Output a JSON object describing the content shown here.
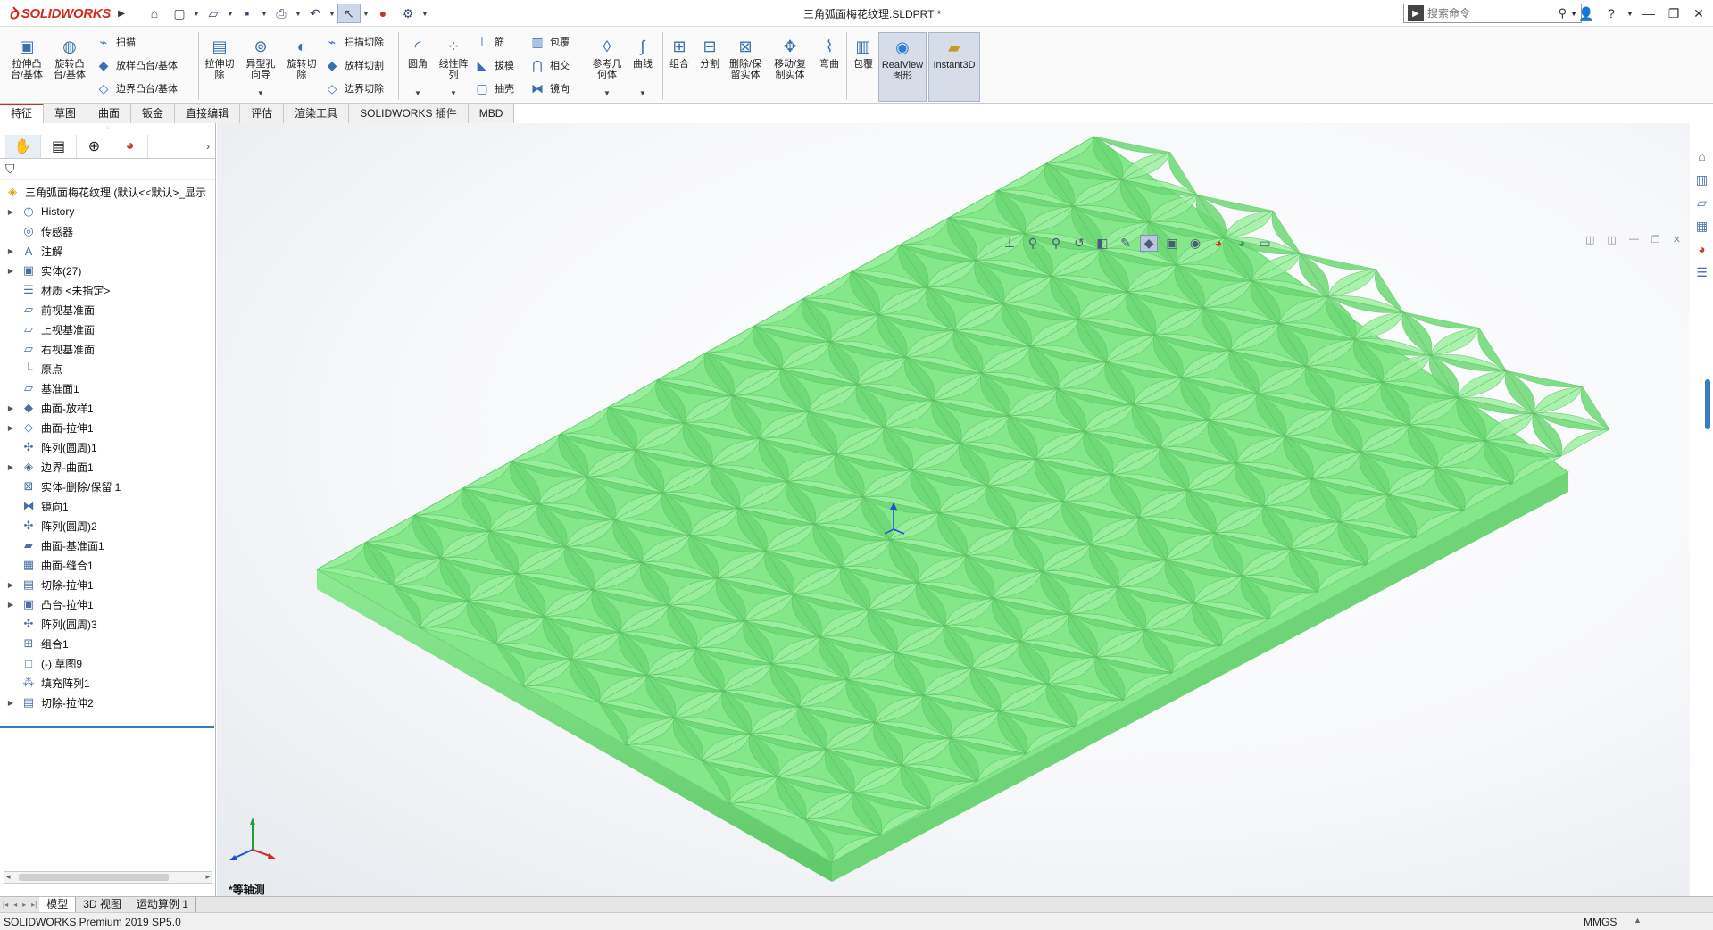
{
  "app": {
    "brand": "SOLIDWORKS",
    "doc_title": "三角弧面梅花纹理.SLDPRT *"
  },
  "search": {
    "placeholder": "搜索命令"
  },
  "toolbar": {
    "large_tools": [
      {
        "label": "拉伸凸\n台/基体",
        "icon": "extrude-boss-icon"
      },
      {
        "label": "旋转凸\n台/基体",
        "icon": "revolve-boss-icon"
      },
      {
        "label": "拉伸切\n除",
        "icon": "extrude-cut-icon"
      },
      {
        "label": "异型孔\n向导",
        "icon": "hole-wizard-icon"
      },
      {
        "label": "旋转切\n除",
        "icon": "revolve-cut-icon"
      },
      {
        "label": "圆角",
        "icon": "fillet-icon"
      },
      {
        "label": "线性阵\n列",
        "icon": "linear-pattern-icon"
      },
      {
        "label": "参考几\n何体",
        "icon": "reference-geometry-icon"
      },
      {
        "label": "曲线",
        "icon": "curves-icon"
      },
      {
        "label": "组合",
        "icon": "combine-icon"
      },
      {
        "label": "分割",
        "icon": "split-icon"
      },
      {
        "label": "删除/保\n留实体",
        "icon": "delete-keep-body-icon"
      },
      {
        "label": "移动/复\n制实体",
        "icon": "move-copy-body-icon"
      },
      {
        "label": "弯曲",
        "icon": "flex-icon"
      },
      {
        "label": "包覆",
        "icon": "wrap-icon"
      },
      {
        "label": "RealView\n图形",
        "icon": "realview-icon"
      },
      {
        "label": "Instant3D",
        "icon": "instant3d-icon"
      }
    ],
    "small_tools": [
      {
        "label": "扫描",
        "icon": "sweep-icon"
      },
      {
        "label": "放样凸台/基体",
        "icon": "loft-icon"
      },
      {
        "label": "边界凸台/基体",
        "icon": "boundary-boss-icon"
      },
      {
        "label": "扫描切除",
        "icon": "swept-cut-icon"
      },
      {
        "label": "放样切割",
        "icon": "lofted-cut-icon"
      },
      {
        "label": "边界切除",
        "icon": "boundary-cut-icon"
      },
      {
        "label": "筋",
        "icon": "rib-icon"
      },
      {
        "label": "拔模",
        "icon": "draft-icon"
      },
      {
        "label": "抽壳",
        "icon": "shell-icon"
      },
      {
        "label": "包覆",
        "icon": "wrap-icon"
      },
      {
        "label": "相交",
        "icon": "intersect-icon"
      },
      {
        "label": "镜向",
        "icon": "mirror-icon"
      }
    ]
  },
  "tabs": [
    "特征",
    "草图",
    "曲面",
    "钣金",
    "直接编辑",
    "评估",
    "渲染工具",
    "SOLIDWORKS 插件",
    "MBD"
  ],
  "tree": {
    "root": "三角弧面梅花纹理 (默认<<默认>_显示",
    "items": [
      {
        "label": "History",
        "expandable": true,
        "icon": "history-icon"
      },
      {
        "label": "传感器",
        "expandable": false,
        "icon": "sensors-icon"
      },
      {
        "label": "注解",
        "expandable": true,
        "icon": "annotations-icon"
      },
      {
        "label": "实体(27)",
        "expandable": true,
        "icon": "solid-bodies-icon"
      },
      {
        "label": "材质 <未指定>",
        "expandable": false,
        "icon": "material-icon"
      },
      {
        "label": "前视基准面",
        "expandable": false,
        "icon": "plane-icon"
      },
      {
        "label": "上视基准面",
        "expandable": false,
        "icon": "plane-icon"
      },
      {
        "label": "右视基准面",
        "expandable": false,
        "icon": "plane-icon"
      },
      {
        "label": "原点",
        "expandable": false,
        "icon": "origin-icon"
      },
      {
        "label": "基准面1",
        "expandable": false,
        "icon": "plane-icon"
      },
      {
        "label": "曲面-放样1",
        "expandable": true,
        "icon": "surface-loft-icon"
      },
      {
        "label": "曲面-拉伸1",
        "expandable": true,
        "icon": "surface-extrude-icon"
      },
      {
        "label": "阵列(圆周)1",
        "expandable": false,
        "icon": "circular-pattern-icon"
      },
      {
        "label": "边界-曲面1",
        "expandable": true,
        "icon": "boundary-surface-icon"
      },
      {
        "label": "实体-删除/保留 1",
        "expandable": false,
        "icon": "delete-keep-body-icon"
      },
      {
        "label": "镜向1",
        "expandable": false,
        "icon": "mirror-icon"
      },
      {
        "label": "阵列(圆周)2",
        "expandable": false,
        "icon": "circular-pattern-icon"
      },
      {
        "label": "曲面-基准面1",
        "expandable": false,
        "icon": "planar-surface-icon"
      },
      {
        "label": "曲面-缝合1",
        "expandable": false,
        "icon": "knit-surface-icon"
      },
      {
        "label": "切除-拉伸1",
        "expandable": true,
        "icon": "extrude-cut-icon"
      },
      {
        "label": "凸台-拉伸1",
        "expandable": true,
        "icon": "extrude-boss-icon"
      },
      {
        "label": "阵列(圆周)3",
        "expandable": false,
        "icon": "circular-pattern-icon"
      },
      {
        "label": "组合1",
        "expandable": false,
        "icon": "combine-icon"
      },
      {
        "label": "(-) 草图9",
        "expandable": false,
        "icon": "sketch-icon"
      },
      {
        "label": "填充阵列1",
        "expandable": false,
        "icon": "fill-pattern-icon"
      },
      {
        "label": "切除-拉伸2",
        "expandable": true,
        "icon": "extrude-cut-icon"
      }
    ]
  },
  "viewport": {
    "view_label": "*等轴测",
    "part_color": "#7fe585"
  },
  "bottom_tabs": [
    "模型",
    "3D 视图",
    "运动算例 1"
  ],
  "status": {
    "version": "SOLIDWORKS Premium 2019 SP5.0",
    "units": "MMGS"
  }
}
